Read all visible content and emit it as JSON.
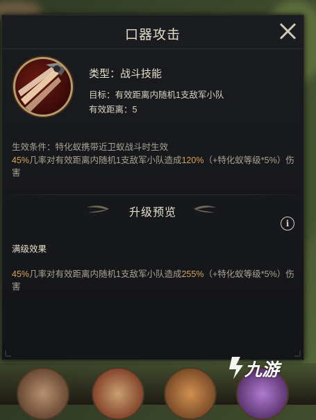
{
  "dialog": {
    "title": "口器攻击",
    "close_icon": "close-icon"
  },
  "skill": {
    "icon": "claw-strike-icon",
    "type_label": "类型：战斗技能",
    "target_label": "目标：有效距离内随机1支敌军小队",
    "range_label": "有效距离：5",
    "condition_label": "生效条件：特化蚁携带近卫蚁战斗时生效",
    "effect": {
      "pct": "45%",
      "text_a": "几率对有效距离内随机1支敌军小队造成",
      "damage": "120%",
      "text_b": "（+特化蚁等级*5%）伤害"
    }
  },
  "upgrade_preview": {
    "title": "升级预览",
    "info_icon": "info-icon",
    "info_glyph": "i",
    "max_level_label": "满级效果",
    "effect": {
      "pct": "45%",
      "text_a": "几率对有效距离内随机1支敌军小队造成",
      "damage": "255%",
      "text_b": "（+特化蚁等级*5%）伤害"
    }
  },
  "watermark": {
    "text": "九游",
    "logo_icon": "jiuyou-logo-icon"
  },
  "colors": {
    "panel_bg": "#17181b",
    "highlight": "#d6a455",
    "title_text": "#e4ddcb",
    "body_text": "#a9a392"
  }
}
